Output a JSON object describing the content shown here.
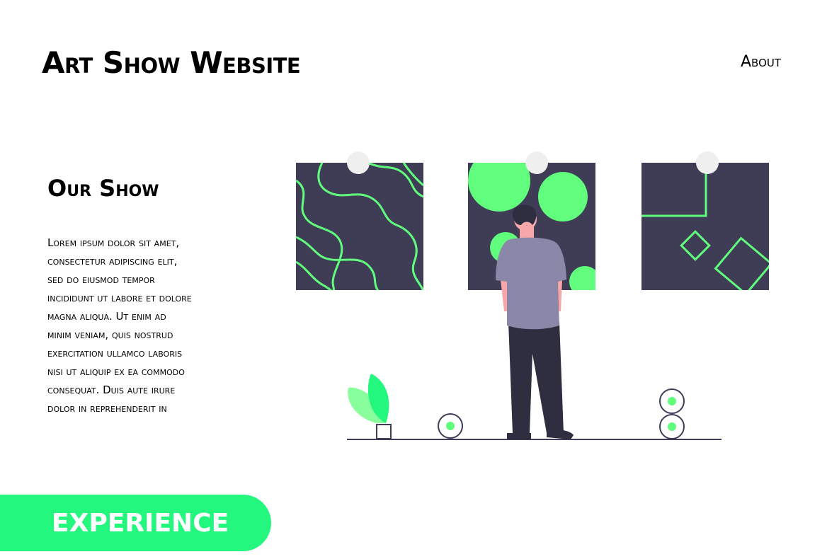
{
  "header": {
    "site_title": "Art Show Website",
    "nav_about": "About"
  },
  "main": {
    "section_heading": "Our Show",
    "body_text": "Lorem ipsum dolor sit amet, consectetur adipiscing elit, sed do eiusmod tempor incididunt ut labore et dolore magna aliqua. Ut enim ad minim veniam, quis nostrud exercitation ullamco laboris nisi ut aliquip ex ea commodo consequat. Duis aute irure dolor in reprehenderit in"
  },
  "cta": {
    "label": "EXPERIENCE"
  },
  "colors": {
    "accent": "#23f77e",
    "art_green": "#61fd7c",
    "panel_dark": "#3f3d56",
    "shirt": "#8b87a8",
    "skin": "#f7a7a9",
    "pants": "#2f2e41",
    "pin": "#efefef"
  }
}
